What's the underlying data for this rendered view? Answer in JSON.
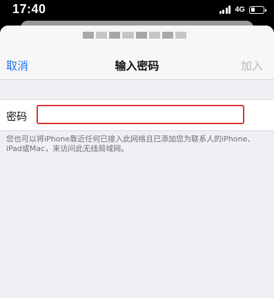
{
  "status_bar": {
    "time": "17:40",
    "network": "4G",
    "signal_bars": 4,
    "battery_level": 0.35
  },
  "nav": {
    "cancel_label": "取消",
    "title": "输入密码",
    "join_label": "加入"
  },
  "form": {
    "password_label": "密码",
    "password_value": ""
  },
  "footnote": {
    "text": "您也可以将iPhone靠近任何已接入此网络且已添加您为联系人的iPhone、iPad或Mac，来访问此无线局域网。"
  },
  "colors": {
    "accent": "#1a73e8",
    "disabled": "#b8b8bc",
    "highlight_border": "#d9302c",
    "background": "#efeff4"
  }
}
